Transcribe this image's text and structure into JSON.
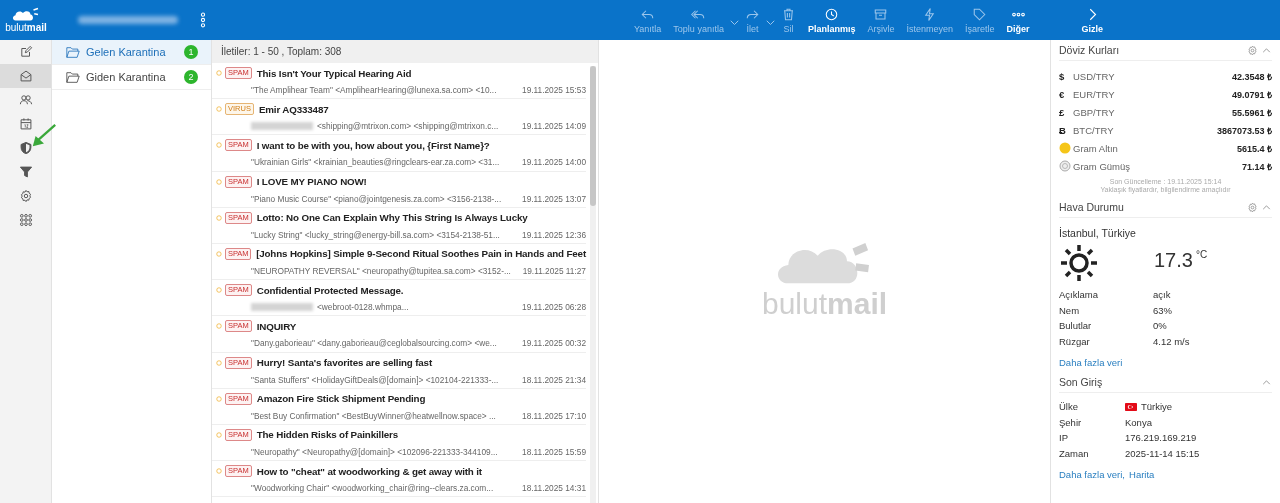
{
  "header": {
    "logo": "bulut**mail**",
    "account_redacted": true
  },
  "toolbar": [
    {
      "label": "Yanıtla",
      "disabled": true,
      "dropdown": false
    },
    {
      "label": "Toplu yanıtla",
      "disabled": true,
      "dropdown": true
    },
    {
      "label": "İlet",
      "disabled": true,
      "dropdown": true
    },
    {
      "label": "Sil",
      "disabled": true,
      "dropdown": false
    },
    {
      "label": "Planlanmış",
      "disabled": false,
      "dropdown": false
    },
    {
      "label": "Arşivle",
      "disabled": true,
      "dropdown": false
    },
    {
      "label": "İstenmeyen",
      "disabled": true,
      "dropdown": false
    },
    {
      "label": "İşaretle",
      "disabled": true,
      "dropdown": false
    },
    {
      "label": "Diğer",
      "disabled": false,
      "dropdown": false
    }
  ],
  "hide_button": {
    "label": "Gizle"
  },
  "nav": [
    {
      "selected": false
    },
    {
      "selected": true
    },
    {
      "selected": false
    },
    {
      "selected": false
    },
    {
      "selected": false
    },
    {
      "selected": false
    },
    {
      "selected": false
    },
    {
      "selected": false
    }
  ],
  "folders": [
    {
      "name": "Gelen Karantina",
      "count": "1",
      "selected": true
    },
    {
      "name": "Giden Karantina",
      "count": "2",
      "selected": false
    }
  ],
  "list_header": "İletiler: 1 - 50 , Toplam: 308",
  "messages": [
    {
      "tag": "SPAM",
      "kind": "spam",
      "subject": "This Isn't Your Typical Hearing Aid",
      "sender_redacted": false,
      "sender": "\"The Amplihear Team\" <AmplihearHearing@lunexa.sa.com> <10...",
      "date": "19.11.2025 15:53"
    },
    {
      "tag": "VIRUS",
      "kind": "virus",
      "subject": "Emir AQ333487",
      "sender_redacted": true,
      "sender": "<shipping@mtrixon.com> <shipping@mtrixon.c...",
      "date": "19.11.2025 14:09"
    },
    {
      "tag": "SPAM",
      "kind": "spam",
      "subject": "I want to be with you, how about you, {First Name}?",
      "sender_redacted": false,
      "sender": "\"Ukrainian Girls\" <krainian_beauties@ringclears-ear.za.com> <31...",
      "date": "19.11.2025 14:00"
    },
    {
      "tag": "SPAM",
      "kind": "spam",
      "subject": "I LOVE MY PIANO NOW!",
      "sender_redacted": false,
      "sender": "\"Piano Music Course\" <piano@jointgenesis.za.com> <3156-2138-...",
      "date": "19.11.2025 13:07"
    },
    {
      "tag": "SPAM",
      "kind": "spam",
      "subject": "Lotto: No One Can Explain Why This String Is Always Lucky",
      "sender_redacted": false,
      "sender": "\"Lucky String\" <lucky_string@energy-bill.sa.com> <3154-2138-51...",
      "date": "19.11.2025 12:36"
    },
    {
      "tag": "SPAM",
      "kind": "spam",
      "subject": "[Johns Hopkins] Simple 9-Second Ritual Soothes Pain in Hands and Feet",
      "sender_redacted": false,
      "sender": "\"NEUROPATHY REVERSAL\" <neuropathy@tupitea.sa.com> <3152-...",
      "date": "19.11.2025 11:27"
    },
    {
      "tag": "SPAM",
      "kind": "spam",
      "subject": "Confidential Protected Message.",
      "sender_redacted": true,
      "sender": "<webroot-0128.whmpa...",
      "date": "19.11.2025 06:28"
    },
    {
      "tag": "SPAM",
      "kind": "spam",
      "subject": "INQUIRY",
      "sender_redacted": false,
      "sender": "\"Dany.gaborieau\" <dany.gaborieau@ceglobalsourcing.com> <we...",
      "date": "19.11.2025 00:32"
    },
    {
      "tag": "SPAM",
      "kind": "spam",
      "subject": "Hurry! Santa's favorites are selling fast",
      "sender_redacted": false,
      "sender": "\"Santa Stuffers\" <HolidayGiftDeals@[domain]> <102104-221333-...",
      "date": "18.11.2025 21:34"
    },
    {
      "tag": "SPAM",
      "kind": "spam",
      "subject": "Amazon Fire Stick Shipment Pending",
      "sender_redacted": false,
      "sender": "\"Best Buy Confirmation\" <BestBuyWinner@heatwellnow.space> ...",
      "date": "18.11.2025 17:10"
    },
    {
      "tag": "SPAM",
      "kind": "spam",
      "subject": "The Hidden Risks of Painkillers",
      "sender_redacted": false,
      "sender": "\"Neuropathy\" <Neuropathy@[domain]> <102096-221333-344109...",
      "date": "18.11.2025 15:59"
    },
    {
      "tag": "SPAM",
      "kind": "spam",
      "subject": "How to \"cheat\" at woodworking & get away with it",
      "sender_redacted": false,
      "sender": "\"Woodworking Chair\" <woodworking_chair@ring--clears.za.com...",
      "date": "18.11.2025 14:31"
    }
  ],
  "preview": {
    "logo": "bulut**mail**"
  },
  "currency": {
    "title": "Döviz Kurları",
    "expanded": true,
    "rates": [
      {
        "symbol": "$",
        "kind": "symbol",
        "name": "USD/TRY",
        "value": "42.3548 ₺"
      },
      {
        "symbol": "€",
        "kind": "symbol",
        "name": "EUR/TRY",
        "value": "49.0791 ₺"
      },
      {
        "symbol": "£",
        "kind": "symbol",
        "name": "GBP/TRY",
        "value": "55.5961 ₺"
      },
      {
        "symbol": "Ƀ",
        "kind": "symbol",
        "name": "BTC/TRY",
        "value": "3867073.53 ₺"
      },
      {
        "kind": "gold",
        "name": "Gram Altın",
        "value": "5615.4 ₺"
      },
      {
        "kind": "silver",
        "name": "Gram Gümüş",
        "value": "71.14 ₺"
      }
    ],
    "updated": "Son Güncelleme : 19.11.2025 15:14",
    "note": "Yaklaşık fiyatlardır, bilgilendirme amaçlıdır"
  },
  "weather": {
    "title": "Hava Durumu",
    "expanded": true,
    "city": "İstanbul, Türkiye",
    "temperature": "17.3",
    "unit": "°C",
    "details": [
      {
        "label": "Açıklama",
        "value": "açık"
      },
      {
        "label": "Nem",
        "value": "63%"
      },
      {
        "label": "Bulutlar",
        "value": "0%"
      },
      {
        "label": "Rüzgar",
        "value": "4.12 m/s"
      }
    ],
    "link": "Daha fazla veri"
  },
  "last_login": {
    "title": "Son Giriş",
    "expanded": true,
    "details": [
      {
        "label": "Ülke",
        "value": "Türkiye",
        "flag": true
      },
      {
        "label": "Şehir",
        "value": "Konya",
        "flag": false
      },
      {
        "label": "IP",
        "value": "176.219.169.219",
        "flag": false
      },
      {
        "label": "Zaman",
        "value": "2025-11-14 15:15",
        "flag": false
      }
    ],
    "links": [
      "Daha fazla veri,",
      "Harita"
    ]
  }
}
